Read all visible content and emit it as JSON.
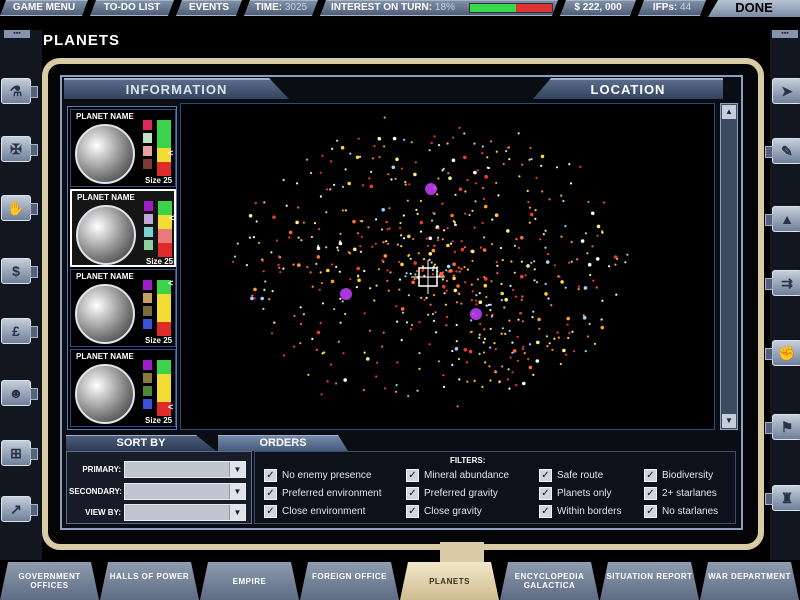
{
  "topbar": {
    "game_menu": "GAME MENU",
    "todo": "TO-DO LIST",
    "events": "EVENTS",
    "time_label": "TIME:",
    "time_value": "3025",
    "interest_label": "INTEREST ON TURN:",
    "interest_value": "18%",
    "interest_fraction": 0.56,
    "money": "$ 222, 000",
    "ifps_label": "IFPs:",
    "ifps_value": "44",
    "done": "DONE"
  },
  "page_title": "PLANETS",
  "tabs": {
    "information": "INFORMATION",
    "location": "LOCATION"
  },
  "planets": [
    {
      "name": "PLANET NAME",
      "size": "Size 25",
      "swatches": [
        "#e0285a",
        "#bfe3c0",
        "#e8a0a0",
        "#7a3a3a"
      ],
      "meter": [
        "#3bd24c",
        "#3bd24c",
        "#f2dc33",
        "#e02b2b"
      ]
    },
    {
      "name": "PLANET NAME",
      "size": "Size 25",
      "swatches": [
        "#a01ec8",
        "#bfa8d8",
        "#7ad2d2",
        "#8fd0a0"
      ],
      "meter": [
        "#3bd24c",
        "#f2dc33",
        "#e87a7a",
        "#e02b2b"
      ]
    },
    {
      "name": "PLANET NAME",
      "size": "Size 25",
      "swatches": [
        "#a01ec8",
        "#c8a060",
        "#7a6a3a",
        "#3a52d8"
      ],
      "meter": [
        "#3bd24c",
        "#f2dc33",
        "#f2dc33",
        "#e02b2b"
      ]
    },
    {
      "name": "PLANET NAME",
      "size": "Size 25",
      "swatches": [
        "#a01ec8",
        "#8a7a3a",
        "#4a8a3a",
        "#3a52d8"
      ],
      "meter": [
        "#3bd24c",
        "#f2dc33",
        "#f2dc33",
        "#e02b2b"
      ]
    }
  ],
  "sort": {
    "tab": "SORT BY",
    "orders_tab": "ORDERS",
    "primary": "PRIMARY:",
    "secondary": "SECONDARY:",
    "view_by": "VIEW BY:"
  },
  "filters": {
    "title": "FILTERS:",
    "items": [
      "No enemy presence",
      "Preferred environment",
      "Close environment",
      "Mineral abundance",
      "Preferred gravity",
      "Close gravity",
      "Safe route",
      "Planets only",
      "Within borders",
      "Biodiversity",
      "2+ starlanes",
      "No starlanes"
    ]
  },
  "nav": [
    "GOVERNMENT OFFICES",
    "HALLS OF POWER",
    "EMPIRE",
    "FOREIGN OFFICE",
    "PLANETS",
    "ENCYCLOPEDIA GALACTICA",
    "SITUATION REPORT",
    "WAR DEPARTMENT"
  ],
  "icons": [
    "flask-icon",
    "crest-icon",
    "globe-hand-icon",
    "dollar-icon",
    "pound-icon",
    "people-icon",
    "network-icon",
    "chart-icon",
    "ship-icon",
    "wrench-icon",
    "fleet-icon",
    "arrows-icon",
    "hand-icon",
    "pin-icon",
    "trophy-icon"
  ]
}
